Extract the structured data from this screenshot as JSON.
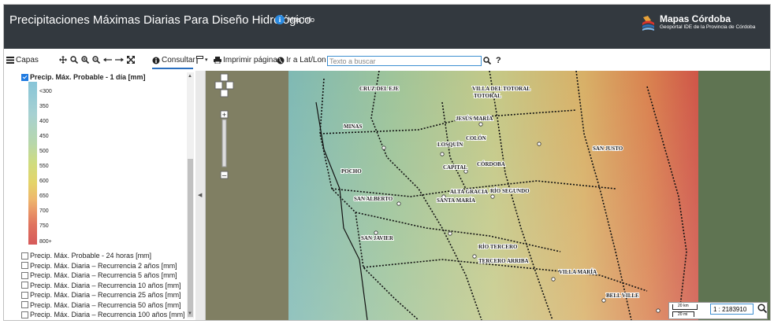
{
  "header": {
    "title": "Precipitaciones Máximas Diarias Para Diseño Hidrológico",
    "info_label": "Más info",
    "logo_name": "Mapas Córdoba",
    "logo_subtitle": "Geoportal IDE de la Provincia de Córdoba"
  },
  "toolbar": {
    "layers_label": "Capas",
    "consultar_label": "Consultar",
    "print_label": "Imprimir página",
    "goto_label": "Ir a Lat/Lon",
    "search_placeholder": "Texto a buscar"
  },
  "sidebar": {
    "active_layer": "Precip. Máx. Probable - 1 día [mm]",
    "legend": [
      "<300",
      "350",
      "400",
      "450",
      "500",
      "550",
      "600",
      "650",
      "700",
      "750",
      "800+"
    ],
    "layers": [
      "Precip. Máx. Probable - 24 horas [mm]",
      "Precip. Máx. Diaria – Recurrencia 2 años [mm]",
      "Precip. Máx. Diaria – Recurrencia 5 años [mm]",
      "Precip. Máx. Diaria – Recurrencia 10 años [mm]",
      "Precip. Máx. Diaria – Recurrencia 25 años [mm]",
      "Precip. Máx. Diaria – Recurrencia 50 años [mm]",
      "Precip. Máx. Diaria – Recurrencia 100 años [mm]"
    ]
  },
  "map": {
    "places": [
      "CRUZ DEL EJE",
      "VILLA DEL TOTORAL",
      "TOTORAL",
      "JESÚS MARÍA",
      "MINAS",
      "COLÓN",
      "LOSQUÍN",
      "SAN JUSTO",
      "POCHO",
      "CAPITAL",
      "CÓRDOBA",
      "ALTA GRACIA",
      "RÍO SEGUNDO",
      "SAN ALBERTO",
      "SANTA MARÍA",
      "SAN JAVIER",
      "RÍO TERCERO",
      "TERCERO ARRIBA",
      "VILLA MARÍA",
      "BELL VILLE"
    ],
    "scale_km": "20 km",
    "scale_mi": "20 mi",
    "scale_value": "1 : 2183910"
  }
}
